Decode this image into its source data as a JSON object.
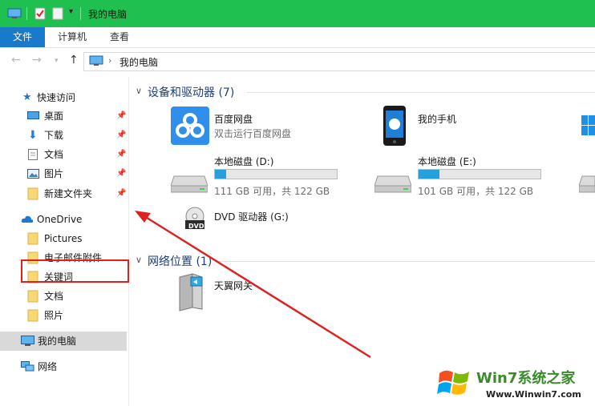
{
  "window": {
    "title": "我的电脑"
  },
  "ribbon": {
    "tabs": [
      {
        "label": "文件"
      },
      {
        "label": "计算机"
      },
      {
        "label": "查看"
      }
    ]
  },
  "address": {
    "crumbs": [
      "我的电脑"
    ]
  },
  "nav": {
    "quick_access": "快速访问",
    "quick_items": [
      {
        "label": "桌面"
      },
      {
        "label": "下载"
      },
      {
        "label": "文档"
      },
      {
        "label": "图片"
      },
      {
        "label": "新建文件夹"
      }
    ],
    "onedrive": "OneDrive",
    "onedrive_items": [
      {
        "label": "Pictures"
      },
      {
        "label": "电子邮件附件"
      },
      {
        "label": "关键词"
      },
      {
        "label": "文档"
      },
      {
        "label": "照片"
      }
    ],
    "this_pc": "我的电脑",
    "network": "网络"
  },
  "devices": {
    "header": "设备和驱动器 (7)",
    "baidu": {
      "name": "百度网盘",
      "sub": "双击运行百度网盘"
    },
    "phone": {
      "name": "我的手机"
    },
    "drive_d": {
      "name": "本地磁盘 (D:)",
      "info": "111 GB 可用，共 122 GB",
      "used_fraction": 0.09
    },
    "drive_e": {
      "name": "本地磁盘 (E:)",
      "info": "101 GB 可用，共 122 GB",
      "used_fraction": 0.17
    },
    "dvd": {
      "name": "DVD 驱动器 (G:)",
      "badge": "DVD"
    }
  },
  "network_locations": {
    "header": "网络位置 (1)",
    "gateway": {
      "name": "天翼网关"
    }
  },
  "watermark": {
    "brand": "Win7系统之家",
    "url": "Www.Winwin7.com"
  },
  "colors": {
    "titlebar": "#20c050",
    "file_tab": "#1979ca",
    "usage_bar": "#26a0da",
    "annotation": "#e02020"
  }
}
